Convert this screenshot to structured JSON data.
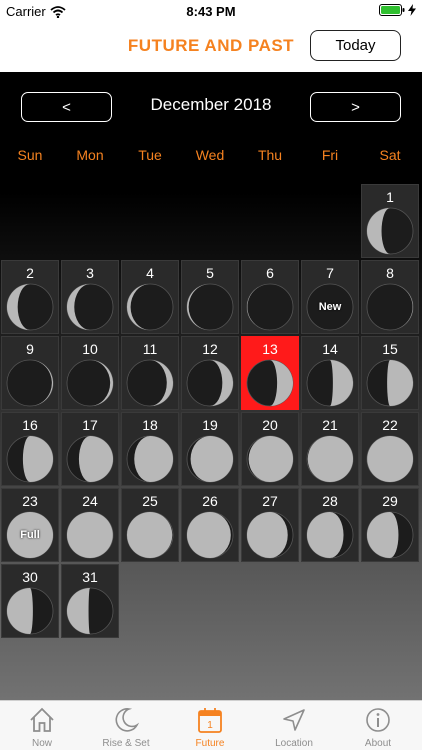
{
  "status": {
    "carrier": "Carrier",
    "time": "8:43 PM"
  },
  "nav": {
    "title": "FUTURE AND PAST",
    "today_label": "Today"
  },
  "calendar": {
    "month": "December 2018",
    "prev_label": "<",
    "next_label": ">",
    "weekdays": [
      "Sun",
      "Mon",
      "Tue",
      "Wed",
      "Thu",
      "Fri",
      "Sat"
    ],
    "first_weekday_index": 6,
    "selected_day": 13,
    "days": [
      {
        "day": "1",
        "phase": 0.81
      },
      {
        "day": "2",
        "phase": 0.84
      },
      {
        "day": "3",
        "phase": 0.87
      },
      {
        "day": "4",
        "phase": 0.91
      },
      {
        "day": "5",
        "phase": 0.94
      },
      {
        "day": "6",
        "phase": 0.97
      },
      {
        "day": "7",
        "phase": 0.0,
        "label": "New"
      },
      {
        "day": "8",
        "phase": 0.03
      },
      {
        "day": "9",
        "phase": 0.05
      },
      {
        "day": "10",
        "phase": 0.08
      },
      {
        "day": "11",
        "phase": 0.12
      },
      {
        "day": "12",
        "phase": 0.16
      },
      {
        "day": "13",
        "phase": 0.2
      },
      {
        "day": "14",
        "phase": 0.23
      },
      {
        "day": "15",
        "phase": 0.27
      },
      {
        "day": "16",
        "phase": 0.3
      },
      {
        "day": "17",
        "phase": 0.33
      },
      {
        "day": "18",
        "phase": 0.37
      },
      {
        "day": "19",
        "phase": 0.41
      },
      {
        "day": "20",
        "phase": 0.44
      },
      {
        "day": "21",
        "phase": 0.46
      },
      {
        "day": "22",
        "phase": 0.48
      },
      {
        "day": "23",
        "phase": 0.5,
        "label": "Full"
      },
      {
        "day": "24",
        "phase": 0.52
      },
      {
        "day": "25",
        "phase": 0.54
      },
      {
        "day": "26",
        "phase": 0.57
      },
      {
        "day": "27",
        "phase": 0.61
      },
      {
        "day": "28",
        "phase": 0.65
      },
      {
        "day": "29",
        "phase": 0.69
      },
      {
        "day": "30",
        "phase": 0.73
      },
      {
        "day": "31",
        "phase": 0.76
      }
    ]
  },
  "tabs": [
    {
      "label": "Now",
      "icon": "house-icon"
    },
    {
      "label": "Rise & Set",
      "icon": "crescent-moon-icon"
    },
    {
      "label": "Future",
      "icon": "calendar-icon",
      "badge": "1",
      "active": true
    },
    {
      "label": "Location",
      "icon": "location-arrow-icon"
    },
    {
      "label": "About",
      "icon": "info-icon"
    }
  ],
  "colors": {
    "accent": "#f58220",
    "today": "#ff1a1a",
    "moon_lit": "#b8b8b8",
    "moon_dark": "#1c1c1c"
  }
}
